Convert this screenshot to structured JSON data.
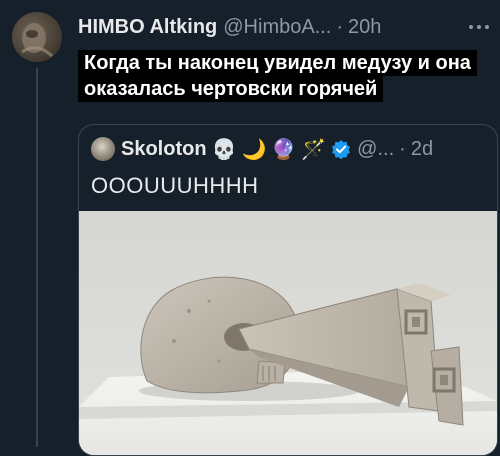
{
  "tweet": {
    "author_name": "HIMBO Altking",
    "handle": "@HimboA...",
    "separator": "·",
    "time": "20h",
    "caption": "Когда ты наконец увидел медузу и она оказалась чертовски горячей"
  },
  "quote": {
    "author_name": "Skoloton",
    "name_emojis": [
      "💀",
      "🌙",
      "🔮",
      "🪄"
    ],
    "handle": "@...",
    "separator": "·",
    "time": "2d",
    "text": "OOOUUUHHHH"
  },
  "icons": {
    "more": "more-options-icon",
    "verified": "verified-badge-icon"
  },
  "colors": {
    "background": "#15202b",
    "border": "#38444d",
    "muted_text": "#8b98a5",
    "verified": "#1d9bf0"
  }
}
